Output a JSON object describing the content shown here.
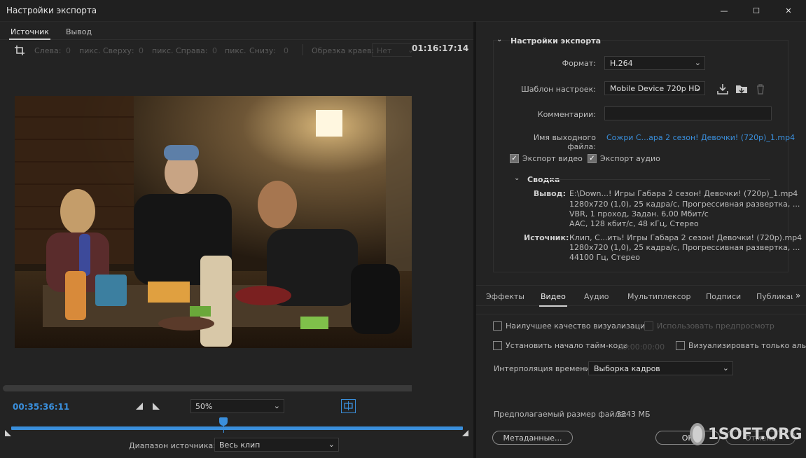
{
  "window": {
    "title": "Настройки экспорта",
    "minimize_glyph": "—",
    "maximize_glyph": "☐",
    "close_glyph": "✕"
  },
  "left": {
    "tabs": [
      "Источник",
      "Вывод"
    ],
    "crop": {
      "left_label": "Слева:",
      "left_value": "0",
      "left_unit": "пикс.",
      "top_label": "Сверху:",
      "top_value": "0",
      "top_unit": "пикс.",
      "right_label": "Справа:",
      "right_value": "0",
      "right_unit": "пикс.",
      "bottom_label": "Снизу:",
      "bottom_value": "0",
      "aspect_label": "Обрезка краев:",
      "aspect_value": "Нет"
    },
    "playback": {
      "current_time": "00:35:36:11",
      "zoom": "50%",
      "duration": "01:16:17:14",
      "timeline_position_fraction": 0.47
    },
    "source_range_label": "Диапазон источника:",
    "source_range_value": "Весь клип"
  },
  "right": {
    "section_title": "Настройки экспорта",
    "format_label": "Формат:",
    "format_value": "H.264",
    "preset_label": "Шаблон настроек:",
    "preset_value": "Mobile Device 720p HD",
    "comments_label": "Комментарии:",
    "comments_value": "",
    "output_name_label": "Имя выходного файла:",
    "output_name_value": "Сожри С...ара 2 сезон! Девочки! (720p)_1.mp4",
    "export_video_label": "Экспорт видео",
    "export_audio_label": "Экспорт аудио",
    "summary_title": "Сводка",
    "summary": {
      "output_label": "Вывод:",
      "output_lines": [
        "E:\\Down...! Игры Габара 2 сезон! Девочки! (720p)_1.mp4",
        "1280x720 (1,0), 25 кадра/с, Прогрессивная развертка, ...",
        "VBR, 1 проход, Задан. 6,00 Мбит/с",
        "AAC, 128 кбит/с, 48 кГц, Стерео"
      ],
      "source_label": "Источник:",
      "source_lines": [
        "Клип, С...ить! Игры Габара 2 сезон! Девочки! (720p).mp4",
        "1280x720 (1,0), 25 кадра/с, Прогрессивная развертка, ...",
        "44100 Гц, Стерео"
      ]
    },
    "tabs": [
      "Эффекты",
      "Видео",
      "Аудио",
      "Мультиплексор",
      "Подписи",
      "Публикац"
    ],
    "tabs_more": "»",
    "options": {
      "max_render_quality": "Наилучшее качество визуализации",
      "use_previews": "Использовать предпросмотр",
      "set_start_timecode": "Установить начало тайм-кода",
      "start_timecode_value": "00:00:00:00",
      "render_alpha_only": "Визуализировать только альфа-",
      "time_interpolation_label": "Интерполяция времени:",
      "time_interpolation_value": "Выборка кадров"
    },
    "file_size_label": "Предполагаемый размер файла:",
    "file_size_value": "3343 МБ",
    "metadata_button": "Метаданные...",
    "ok_button": "ОК",
    "cancel_button": "Отмена"
  },
  "watermark": "1SOFT.ORG"
}
